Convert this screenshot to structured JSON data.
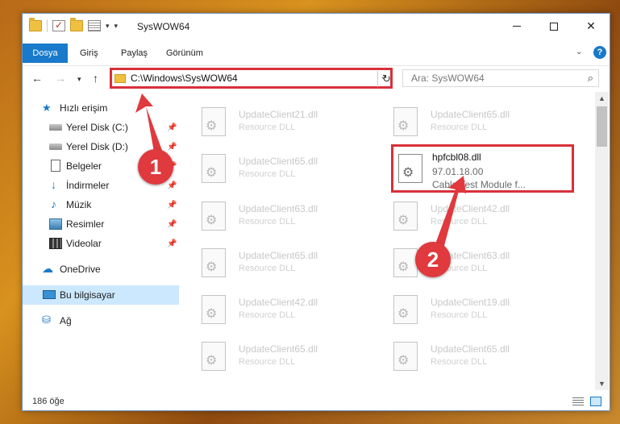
{
  "window": {
    "title": "SysWOW64",
    "controls": {
      "minimize": "minimize-icon",
      "maximize": "maximize-icon",
      "close": "✕"
    }
  },
  "ribbon": {
    "tabs": [
      {
        "label": "Dosya"
      },
      {
        "label": "Giriş"
      },
      {
        "label": "Paylaş"
      },
      {
        "label": "Görünüm"
      }
    ],
    "help": "?"
  },
  "address": {
    "path": "C:\\Windows\\SysWOW64",
    "search_placeholder": "Ara: SysWOW64"
  },
  "sidebar": {
    "items": [
      {
        "label": "Hızlı erişim",
        "icon": "star-icon"
      },
      {
        "label": "Yerel Disk (C:)",
        "icon": "disk-icon",
        "pinned": true
      },
      {
        "label": "Yerel Disk (D:)",
        "icon": "disk-icon",
        "pinned": true
      },
      {
        "label": "Belgeler",
        "icon": "document-icon",
        "pinned": true
      },
      {
        "label": "İndirmeler",
        "icon": "download-icon",
        "pinned": true
      },
      {
        "label": "Müzik",
        "icon": "music-icon",
        "pinned": true
      },
      {
        "label": "Resimler",
        "icon": "pictures-icon",
        "pinned": true
      },
      {
        "label": "Videolar",
        "icon": "video-icon",
        "pinned": true
      },
      {
        "label": "OneDrive",
        "icon": "cloud-icon"
      },
      {
        "label": "Bu bilgisayar",
        "icon": "computer-icon",
        "selected": true
      },
      {
        "label": "Ağ",
        "icon": "network-icon"
      }
    ]
  },
  "files": [
    {
      "name": "UpdateClient21.dll",
      "desc": "Resource DLL"
    },
    {
      "name": "UpdateClient65.dll",
      "desc": "Resource DLL"
    },
    {
      "name": "UpdateClient65.dll",
      "desc": "Resource DLL"
    },
    {
      "name": "hpfcbl08.dll",
      "version": "97.01.18.00",
      "desc": "Cable Test Module f..."
    },
    {
      "name": "UpdateClient63.dll",
      "desc": "Resource DLL"
    },
    {
      "name": "UpdateClient42.dll",
      "desc": "Resource DLL"
    },
    {
      "name": "UpdateClient65.dll",
      "desc": "Resource DLL"
    },
    {
      "name": "UpdateClient63.dll",
      "desc": "Resource DLL"
    },
    {
      "name": "UpdateClient42.dll",
      "desc": "Resource DLL"
    },
    {
      "name": "UpdateClient19.dll",
      "desc": "Resource DLL"
    },
    {
      "name": "UpdateClient65.dll",
      "desc": "Resource DLL"
    },
    {
      "name": "UpdateClient65.dll",
      "desc": "Resource DLL"
    }
  ],
  "status": {
    "count": "186 öğe"
  },
  "annotations": {
    "step1": "1",
    "step2": "2",
    "color": "#e0393e"
  }
}
